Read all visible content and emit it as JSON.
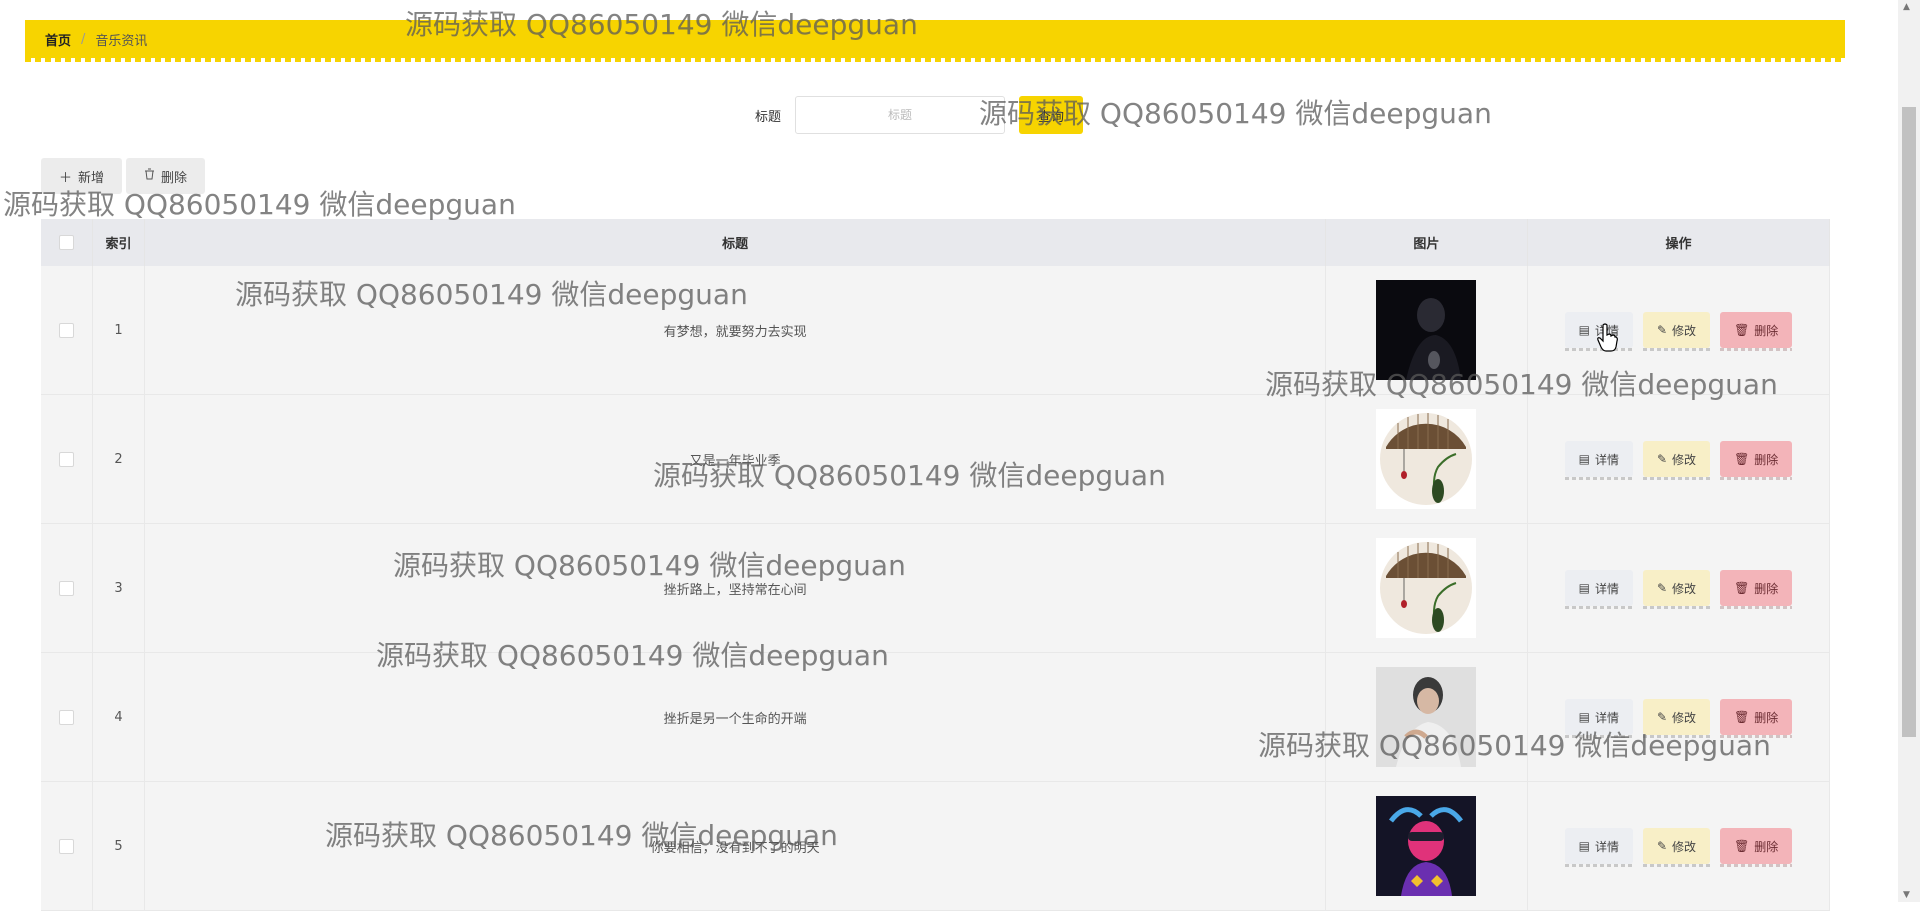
{
  "breadcrumb": {
    "home": "首页",
    "separator": "/",
    "current": "音乐资讯"
  },
  "search": {
    "label": "标题",
    "placeholder": "标题",
    "button": "查询"
  },
  "actions": {
    "add": "新增",
    "delete": "删除"
  },
  "table": {
    "headers": {
      "index": "索引",
      "title": "标题",
      "image": "图片",
      "operations": "操作"
    },
    "rows": [
      {
        "index": "1",
        "title": "有梦想，就要努力去实现"
      },
      {
        "index": "2",
        "title": "又是一年毕业季"
      },
      {
        "index": "3",
        "title": "挫折路上，坚持常在心间"
      },
      {
        "index": "4",
        "title": "挫折是另一个生命的开端"
      },
      {
        "index": "5",
        "title": "你要相信，没有到不了的明天"
      }
    ],
    "ops": {
      "detail": "详情",
      "edit": "修改",
      "delete": "删除"
    }
  },
  "watermark": "源码获取 QQ86050149 微信deepguan",
  "colors": {
    "accent": "#f7d400",
    "delete": "#f3b4b9",
    "edit": "#f8efc7"
  }
}
